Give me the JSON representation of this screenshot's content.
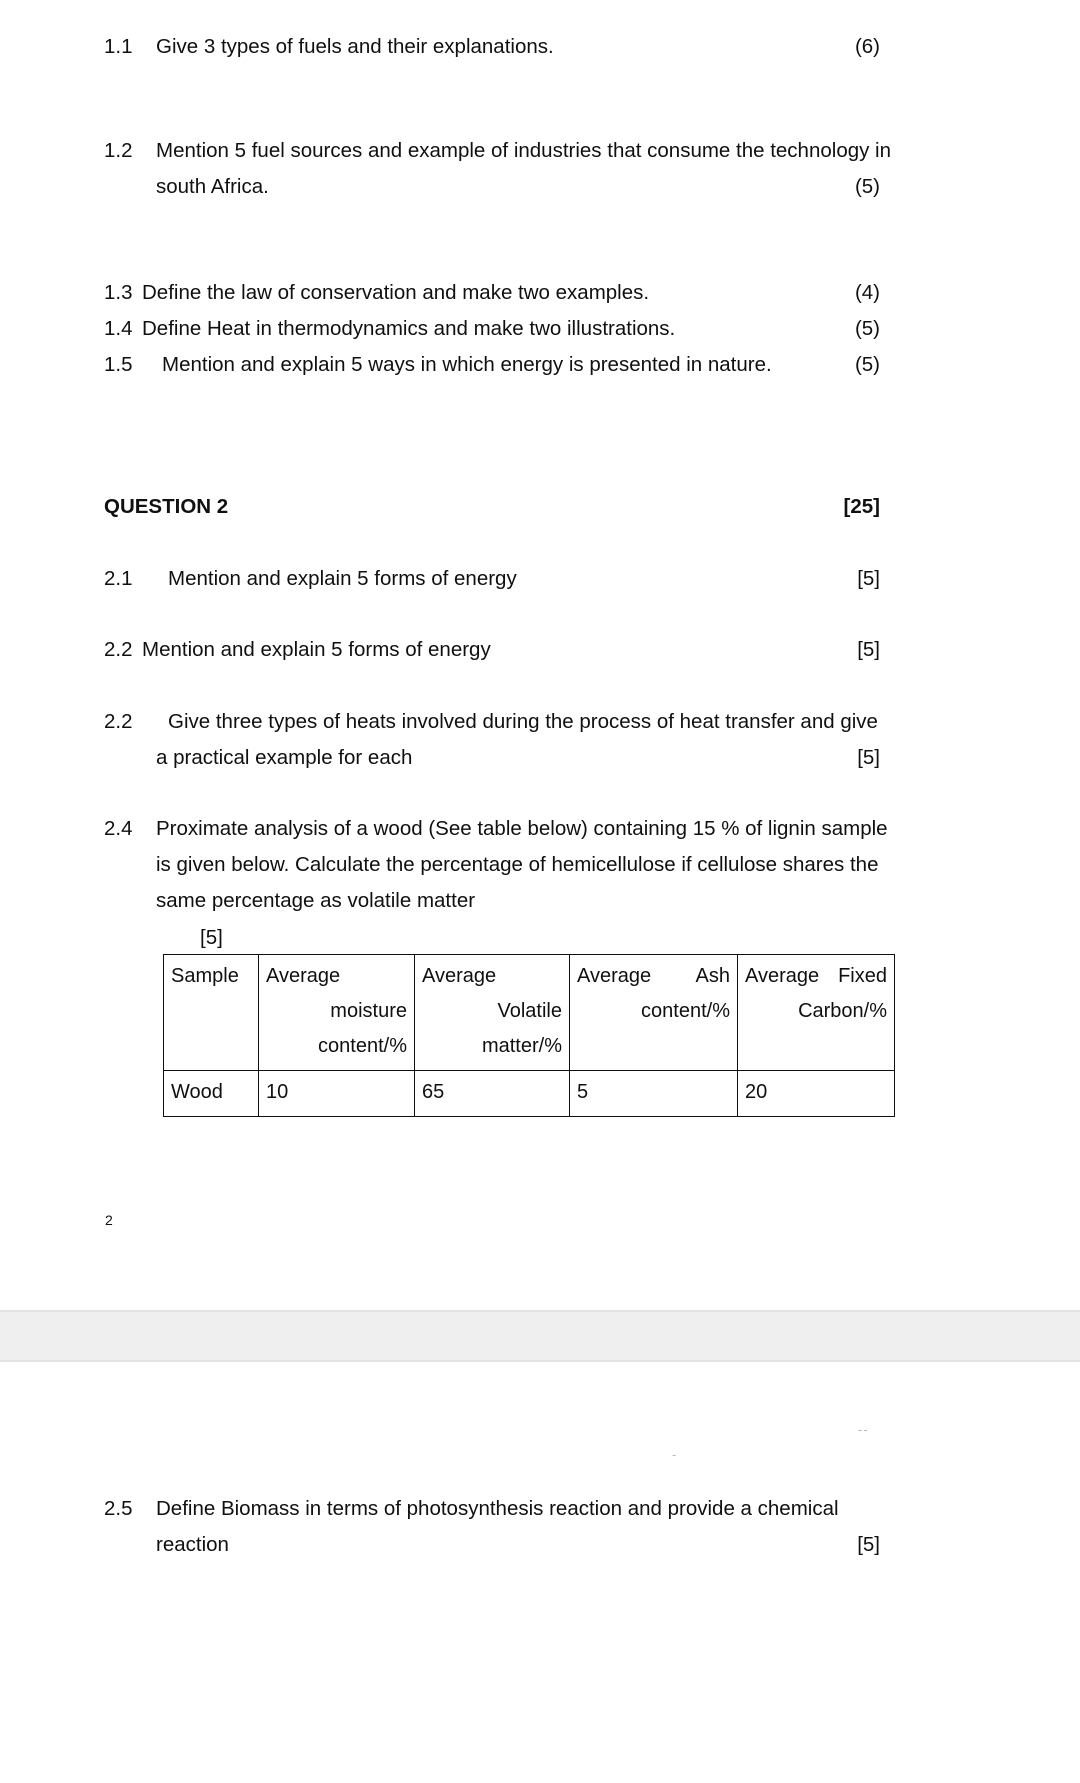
{
  "document": {
    "page_number_label": "2"
  },
  "page_one": {
    "questions": [
      {
        "number": "1.1",
        "lines": [
          "Give 3 types of fuels and their explanations."
        ],
        "marks": "(6)"
      },
      {
        "number": "1.2",
        "lines": [
          "Mention 5 fuel sources and example of industries that consume the technology in",
          "south Africa."
        ],
        "marks": "(5)"
      },
      {
        "number": "1.3",
        "lines": [
          "Define the law of conservation and make two examples."
        ],
        "marks": "(4)"
      },
      {
        "number": "1.4",
        "lines": [
          "Define Heat in thermodynamics and make two illustrations."
        ],
        "marks": "(5)"
      },
      {
        "number": "1.5",
        "lines": [
          "Mention and explain 5 ways in which energy is presented in nature."
        ],
        "marks": "(5)"
      }
    ],
    "question2_heading": {
      "title": "QUESTION 2",
      "total_marks": "[25]"
    },
    "section2": [
      {
        "number": "2.1",
        "lines": [
          "Mention and explain 5 forms of energy"
        ],
        "marks": "[5]"
      },
      {
        "number": "2.2",
        "lines": [
          "Mention and explain 5 forms of energy"
        ],
        "marks": "[5]"
      },
      {
        "number": "2.2",
        "lines": [
          "Give three types of heats involved during the process of heat transfer and give",
          "a practical example for each"
        ],
        "marks": "[5]"
      },
      {
        "number": "2.4",
        "lines": [
          "Proximate analysis of a wood (See table below) containing 15 % of lignin sample",
          "is given below. Calculate the percentage of hemicellulose if cellulose shares the",
          "same percentage as volatile matter"
        ],
        "marks": "[5]"
      }
    ],
    "table": {
      "headers": [
        {
          "line1": "Sample",
          "line2": "",
          "line3": "",
          "split": false
        },
        {
          "line1": "Average",
          "line2": "moisture",
          "line3": "content/%",
          "split": false
        },
        {
          "line1": "Average",
          "line2": "Volatile",
          "line3": "matter/%",
          "split": false
        },
        {
          "line1": "Average",
          "line1b": "Ash",
          "line2": "content/%",
          "line3": "",
          "split": true
        },
        {
          "line1": "Average",
          "line1b": "Fixed",
          "line2": "Carbon/%",
          "line3": "",
          "split": true
        }
      ],
      "rows": [
        [
          "Wood",
          "10",
          "65",
          "5",
          "20"
        ]
      ]
    }
  },
  "page_two": {
    "questions": [
      {
        "number": "2.5",
        "lines": [
          "Define Biomass in terms of photosynthesis reaction and provide a chemical",
          "reaction"
        ],
        "marks": "[5]"
      }
    ],
    "smudges": [
      "--",
      "-"
    ]
  }
}
